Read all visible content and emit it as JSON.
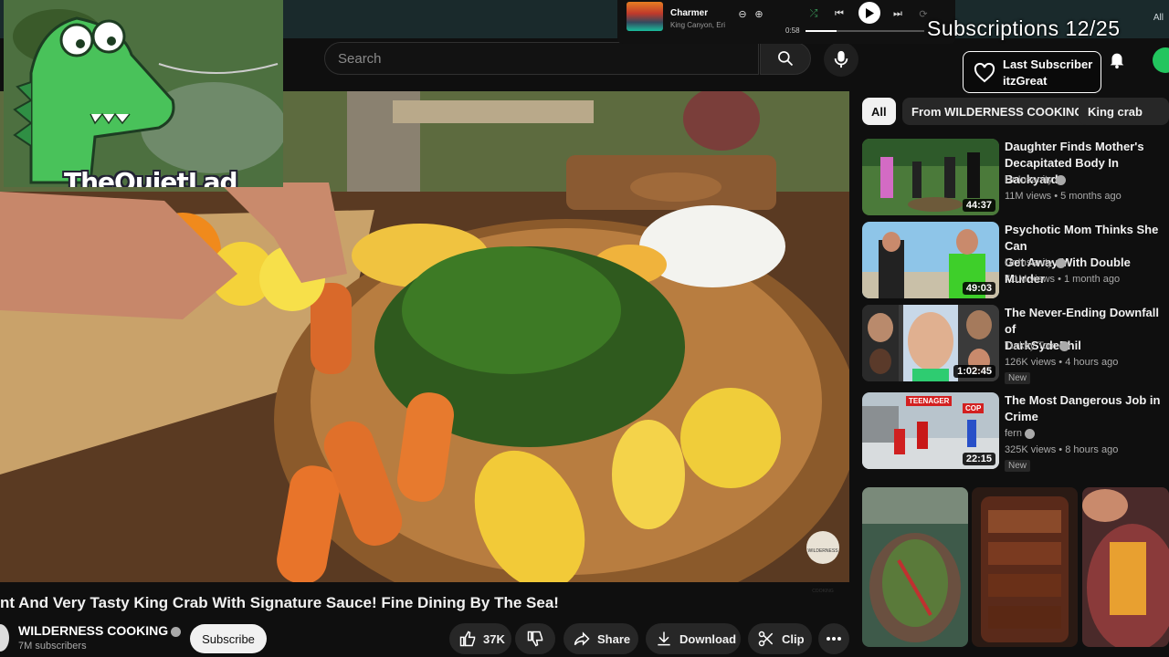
{
  "browser": {
    "tabs_right_label": "All"
  },
  "search": {
    "placeholder": "Search"
  },
  "music_player": {
    "song": "Charmer",
    "artist": "King Canyon, Eri",
    "elapsed": "0:58",
    "progress": 0.26
  },
  "overlay": {
    "subscriptions_label": "Subscriptions 12/25",
    "last_subscriber_label": "Last Subscriber",
    "last_subscriber_name": "itzGreat",
    "streamer_name": "TheQuietLad"
  },
  "video": {
    "title": "nt And Very Tasty King Crab With Signature Sauce! Fine Dining By The Sea!",
    "channel": "WILDERNESS COOKING",
    "subscribers": "7M subscribers",
    "subscribe_label": "Subscribe",
    "likes": "37K",
    "share_label": "Share",
    "download_label": "Download",
    "clip_label": "Clip",
    "watermark": "WILDERNESS COOKING"
  },
  "chips": [
    "All",
    "From WILDERNESS COOKING",
    "King crab"
  ],
  "recommended": [
    {
      "title_line1": "Daughter Finds Mother's",
      "title_line2": "Decapitated Body In Backyard",
      "channel": "Dr Insanity",
      "meta": "11M views • 5 months ago",
      "duration": "44:37",
      "badge": ""
    },
    {
      "title_line1": "Psychotic Mom Thinks She Can",
      "title_line2": "Get Away With Double Murder",
      "channel": "Dr Insanity",
      "meta": "7.1M views • 1 month ago",
      "duration": "49:03",
      "badge": ""
    },
    {
      "title_line1": "The Never-Ending Downfall of",
      "title_line2": "DarkSydePhil",
      "channel": "Turkey Tom",
      "meta": "126K views • 4 hours ago",
      "duration": "1:02:45",
      "badge": "New"
    },
    {
      "title_line1": "The Most Dangerous Job in",
      "title_line2": "Crime",
      "channel": "fern",
      "meta": "325K views • 8 hours ago",
      "duration": "22:15",
      "badge": "New"
    }
  ],
  "thumb_text": {
    "teenager": "TEENAGER",
    "cop": "COP"
  }
}
